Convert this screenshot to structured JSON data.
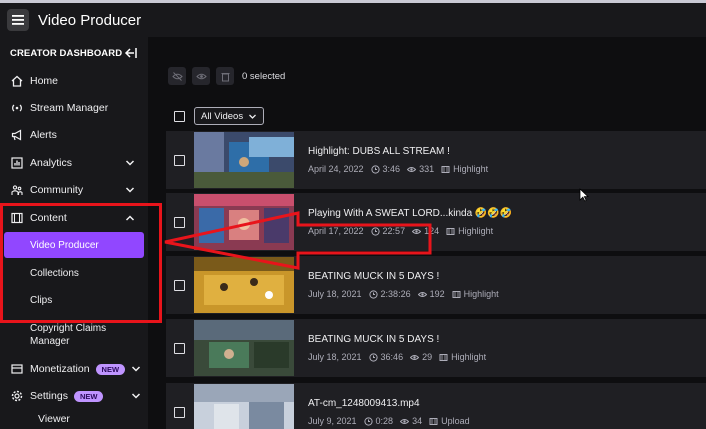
{
  "header": {
    "title": "Video Producer",
    "menu_icon": "hamburger-icon"
  },
  "sidebar": {
    "heading": "CREATOR DASHBOARD",
    "items": [
      {
        "label": "Home",
        "icon": "home-icon"
      },
      {
        "label": "Stream Manager",
        "icon": "broadcast-icon"
      },
      {
        "label": "Alerts",
        "icon": "megaphone-icon"
      },
      {
        "label": "Analytics",
        "icon": "chart-icon",
        "expandable": true
      },
      {
        "label": "Community",
        "icon": "community-icon",
        "expandable": true
      },
      {
        "label": "Content",
        "icon": "content-icon",
        "expandable": true,
        "expanded": true
      }
    ],
    "subitems": [
      {
        "label": "Video Producer",
        "active": true
      },
      {
        "label": "Collections"
      },
      {
        "label": "Clips"
      },
      {
        "label": "Copyright Claims Manager"
      }
    ],
    "bottom_items": [
      {
        "label": "Monetization",
        "badge": "NEW",
        "icon": "monetization-icon"
      },
      {
        "label": "Settings",
        "badge": "NEW",
        "icon": "gear-icon"
      },
      {
        "label": "Viewer",
        "icon": "viewer-icon"
      }
    ]
  },
  "toolbar": {
    "selected": "0 selected"
  },
  "filter": {
    "label": "All Videos"
  },
  "videos": [
    {
      "title": "Highlight: DUBS ALL STREAM !",
      "date": "April 24, 2022",
      "duration": "3:46",
      "views": "331",
      "type": "Highlight"
    },
    {
      "title": "Playing With A SWEAT LORD...kinda 🤣🤣🤣",
      "date": "April 17, 2022",
      "duration": "22:57",
      "views": "124",
      "type": "Highlight"
    },
    {
      "title": "BEATING MUCK IN 5 DAYS !",
      "date": "July 18, 2021",
      "duration": "2:38:26",
      "views": "192",
      "type": "Highlight"
    },
    {
      "title": "BEATING MUCK IN 5 DAYS !",
      "date": "July 18, 2021",
      "duration": "36:46",
      "views": "29",
      "type": "Highlight"
    },
    {
      "title": "AT-cm_1248009413.mp4",
      "date": "July 9, 2021",
      "duration": "0:28",
      "views": "34",
      "type": "Upload"
    }
  ],
  "colors": {
    "accent": "#9147ff",
    "annotation": "#e8141b",
    "badge": "#bf94ff"
  }
}
